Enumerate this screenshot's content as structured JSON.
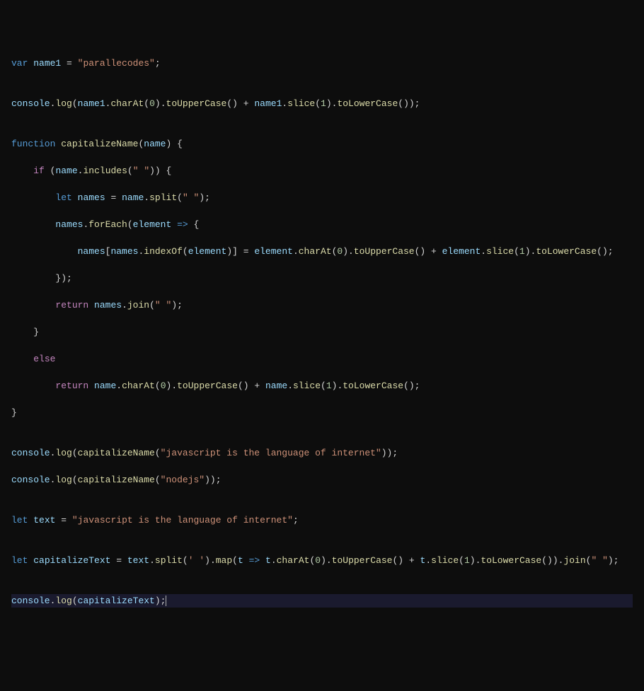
{
  "code": {
    "l1": {
      "kw_var": "var",
      "name1": "name1",
      "eq": " = ",
      "str": "\"parallecodes\"",
      "semi": ";"
    },
    "l3": {
      "console": "console",
      "log": "log",
      "name1": "name1",
      "charAt": "charAt",
      "zero": "0",
      "toUpperCase": "toUpperCase",
      "plus": " + ",
      "slice": "slice",
      "one": "1",
      "toLowerCase": "toLowerCase"
    },
    "l5": {
      "function": "function",
      "capitalizeName": "capitalizeName",
      "name": "name"
    },
    "l6": {
      "if": "if",
      "name": "name",
      "includes": "includes",
      "space": "\" \""
    },
    "l7": {
      "let": "let",
      "names": "names",
      "name": "name",
      "split": "split",
      "space": "\" \""
    },
    "l8": {
      "names": "names",
      "forEach": "forEach",
      "element": "element",
      "arrow": " => "
    },
    "l9": {
      "names": "names",
      "indexOf": "indexOf",
      "element": "element",
      "charAt": "charAt",
      "zero": "0",
      "toUpperCase": "toUpperCase",
      "plus": " + ",
      "slice": "slice",
      "one": "1",
      "toLowerCase": "toLowerCase"
    },
    "l11": {
      "return": "return",
      "names": "names",
      "join": "join",
      "space": "\" \""
    },
    "l13": {
      "else": "else"
    },
    "l14": {
      "return": "return",
      "name": "name",
      "charAt": "charAt",
      "zero": "0",
      "toUpperCase": "toUpperCase",
      "plus": " + ",
      "slice": "slice",
      "one": "1",
      "toLowerCase": "toLowerCase"
    },
    "l17": {
      "console": "console",
      "log": "log",
      "capitalizeName": "capitalizeName",
      "str": "\"javascript is the language of internet\""
    },
    "l18": {
      "console": "console",
      "log": "log",
      "capitalizeName": "capitalizeName",
      "str": "\"nodejs\""
    },
    "l20": {
      "let": "let",
      "text": "text",
      "str": "\"javascript is the language of internet\""
    },
    "l22": {
      "let": "let",
      "capitalizeText": "capitalizeText",
      "text": "text",
      "split": "split",
      "sq": "' '",
      "map": "map",
      "t": "t",
      "arrow": " => ",
      "charAt": "charAt",
      "zero": "0",
      "toUpperCase": "toUpperCase",
      "plus": " + ",
      "slice": "slice",
      "one": "1",
      "toLowerCase": "toLowerCase",
      "join": "join",
      "dq": "\" \""
    },
    "l24": {
      "console": "console",
      "log": "log",
      "capitalizeText": "capitalizeText"
    }
  }
}
